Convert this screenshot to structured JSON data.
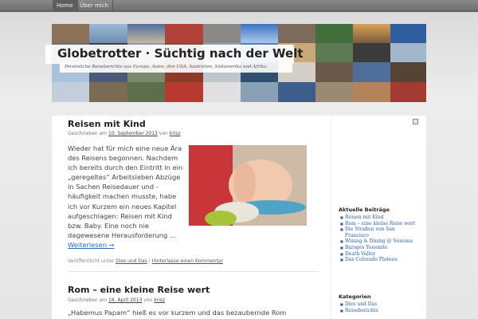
{
  "nav": {
    "items": [
      {
        "label": "Home"
      },
      {
        "label": "Über mich"
      }
    ]
  },
  "header": {
    "title": "Globetrotter · Süchtig nach der Welt",
    "tagline": "Persönliche Reiseberichte aus Europa, Asien, den USA, Australien, Südamerika und Afrika."
  },
  "posts": [
    {
      "title": "Reisen mit Kind",
      "meta_prefix": "Geschrieben am",
      "date": "10. September 2013",
      "by": "von",
      "author": "krisz",
      "excerpt": "Wieder hat für mich eine neue Ära des Reisens begonnen. Nachdem ich bereits durch den Eintritt in ein „geregeltes“ Arbeitsleben Abzüge in Sachen Reisedauer und -häufigkeit machen musste, habe ich vor Kurzem ein neues Kapitel aufgeschlagen: Reisen mit Kind bzw. Baby. Eine noch nie dagewesene Herausforderung …",
      "more": "Weiterlesen →",
      "footer_prefix": "Veröffentlicht unter",
      "category": "Dies und Das",
      "separator": "|",
      "comment": "Hinterlasse einen Kommentar"
    },
    {
      "title": "Rom – eine kleine Reise wert",
      "meta_prefix": "Geschrieben am",
      "date": "16. April 2013",
      "by": "von",
      "author": "krisz",
      "excerpt": "„Habemus Papam“ hieß es vor kurzem und das bezaubernde Rom"
    }
  ],
  "sidebar": {
    "recent_title": "Aktuelle Beiträge",
    "recent": [
      {
        "label": "Reisen mit Kind"
      },
      {
        "label": "Rom – eine kleine Reise wert"
      },
      {
        "label": "Die Straßen von San Francisco"
      },
      {
        "label": "Wining & Dining @ Sonoma"
      },
      {
        "label": "Barsges Yosemite"
      },
      {
        "label": "Death Valley"
      },
      {
        "label": "Das Colorado Plateau"
      }
    ],
    "categories_title": "Kategorien",
    "categories": [
      {
        "label": "Dies und Das"
      },
      {
        "label": "Reiseberichte"
      }
    ]
  },
  "colors": {
    "link": "#2a5fa5",
    "accent": "#2a6ab0",
    "nav_bg": "#6c6c6c"
  },
  "icons": {
    "rss": "rss-feed-icon"
  }
}
